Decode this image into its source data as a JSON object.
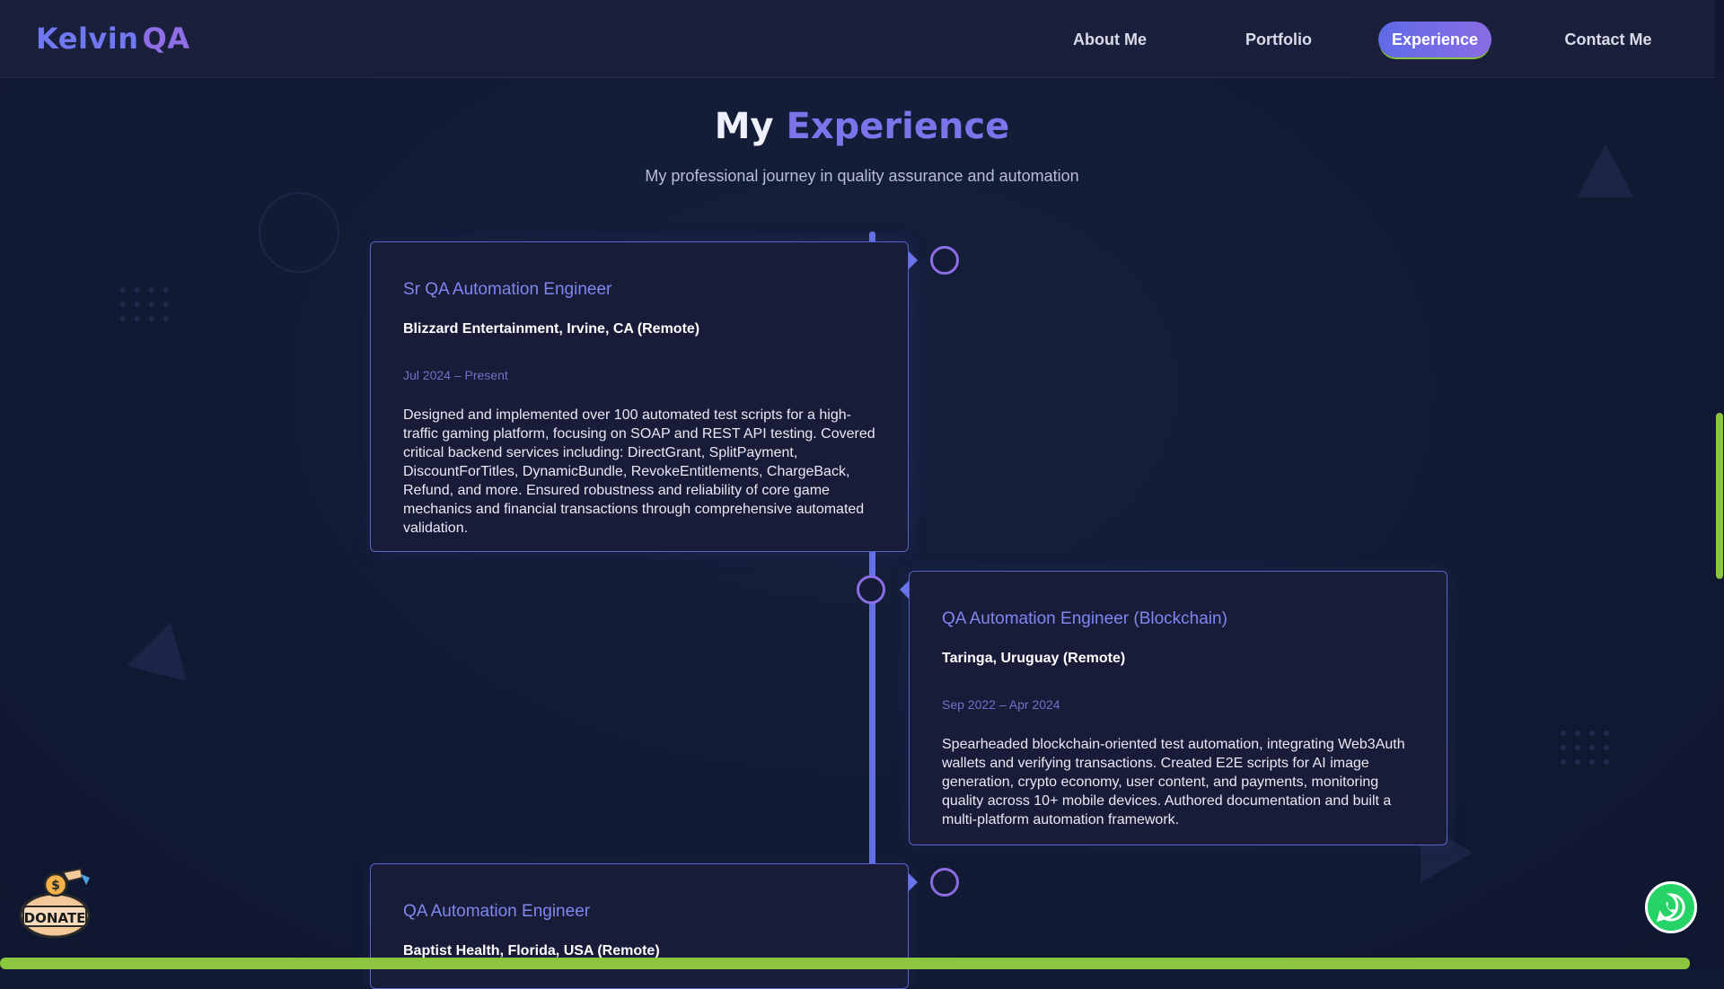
{
  "brand": {
    "part1": "Kelvin",
    "part2": "QA"
  },
  "nav": {
    "items": [
      {
        "label": "About Me"
      },
      {
        "label": "Portfolio"
      },
      {
        "label": "Experience"
      },
      {
        "label": "Contact Me"
      }
    ],
    "active": "Experience"
  },
  "section": {
    "title_part1": "My",
    "title_part2": "Experience",
    "subtitle": "My professional journey in quality assurance and automation"
  },
  "experience": [
    {
      "role": "Sr QA Automation Engineer",
      "company": "Blizzard Entertainment, Irvine, CA (Remote)",
      "dates": "Jul 2024 – Present",
      "description": "Designed and implemented over 100 automated test scripts for a high-traffic gaming platform, focusing on SOAP and REST API testing. Covered critical backend services including: DirectGrant, SplitPayment, DiscountForTitles, DynamicBundle, RevokeEntitlements, ChargeBack, Refund, and more. Ensured robustness and reliability of core game mechanics and financial transactions through comprehensive automated validation."
    },
    {
      "role": "QA Automation Engineer (Blockchain)",
      "company": "Taringa, Uruguay (Remote)",
      "dates": "Sep 2022 – Apr 2024",
      "description": "Spearheaded blockchain-oriented test automation, integrating Web3Auth wallets and verifying transactions. Created E2E scripts for AI image generation, crypto economy, user content, and payments, monitoring quality across 10+ mobile devices. Authored documentation and built a multi-platform automation framework."
    },
    {
      "role": "QA Automation Engineer",
      "company": "Baptist Health, Florida, USA (Remote)",
      "dates": "",
      "description": ""
    }
  ],
  "widgets": {
    "donate_label": "DONATE",
    "donate_icon": "donate-jar-icon",
    "whatsapp_icon": "whatsapp-icon"
  },
  "colors": {
    "accent": "#6470e8",
    "accent_purple": "#8c6de6",
    "scroll_green": "#8cc63f",
    "background": "#111a33",
    "card": "#181c38"
  }
}
